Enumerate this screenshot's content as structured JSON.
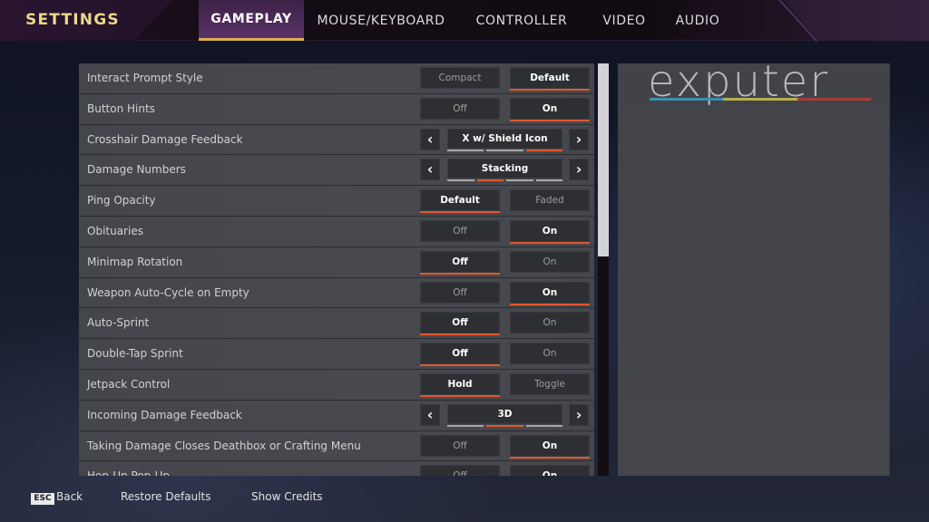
{
  "header": {
    "title": "SETTINGS",
    "tabs": [
      {
        "label": "GAMEPLAY",
        "active": true
      },
      {
        "label": "MOUSE/KEYBOARD",
        "active": false
      },
      {
        "label": "CONTROLLER",
        "active": false
      },
      {
        "label": "VIDEO",
        "active": false
      },
      {
        "label": "AUDIO",
        "active": false
      }
    ]
  },
  "colors": {
    "accent": "#e2572e",
    "tab_underline": "#d9b14a",
    "title": "#ecd88a",
    "logo_bars": [
      "#3f8fa8",
      "#b5b14a",
      "#a83c3c"
    ]
  },
  "settings": [
    {
      "label": "Interact Prompt Style",
      "type": "toggle",
      "options": [
        "Compact",
        "Default"
      ],
      "selected": 1
    },
    {
      "label": "Button Hints",
      "type": "toggle",
      "options": [
        "Off",
        "On"
      ],
      "selected": 1
    },
    {
      "label": "Crosshair Damage Feedback",
      "type": "cycle",
      "value": "X w/ Shield Icon",
      "segments": 3,
      "selected_segment": 2
    },
    {
      "label": "Damage Numbers",
      "type": "cycle",
      "value": "Stacking",
      "segments": 4,
      "selected_segment": 1
    },
    {
      "label": "Ping Opacity",
      "type": "toggle",
      "options": [
        "Default",
        "Faded"
      ],
      "selected": 0
    },
    {
      "label": "Obituaries",
      "type": "toggle",
      "options": [
        "Off",
        "On"
      ],
      "selected": 1
    },
    {
      "label": "Minimap Rotation",
      "type": "toggle",
      "options": [
        "Off",
        "On"
      ],
      "selected": 0
    },
    {
      "label": "Weapon Auto-Cycle on Empty",
      "type": "toggle",
      "options": [
        "Off",
        "On"
      ],
      "selected": 1
    },
    {
      "label": "Auto-Sprint",
      "type": "toggle",
      "options": [
        "Off",
        "On"
      ],
      "selected": 0
    },
    {
      "label": "Double-Tap Sprint",
      "type": "toggle",
      "options": [
        "Off",
        "On"
      ],
      "selected": 0
    },
    {
      "label": "Jetpack Control",
      "type": "toggle",
      "options": [
        "Hold",
        "Toggle"
      ],
      "selected": 0
    },
    {
      "label": "Incoming Damage Feedback",
      "type": "cycle",
      "value": "3D",
      "segments": 3,
      "selected_segment": 1
    },
    {
      "label": "Taking Damage Closes Deathbox or Crafting Menu",
      "type": "toggle",
      "options": [
        "Off",
        "On"
      ],
      "selected": 1
    },
    {
      "label": "Hop-Up Pop-Up",
      "type": "toggle",
      "options": [
        "Off",
        "On"
      ],
      "selected": 1
    }
  ],
  "arrows": {
    "prev": "‹",
    "next": "›"
  },
  "info_panel": {
    "watermark": "exputer"
  },
  "footer": {
    "esc_key": "ESC",
    "back_label": "Back",
    "restore_label": "Restore Defaults",
    "credits_label": "Show Credits"
  }
}
